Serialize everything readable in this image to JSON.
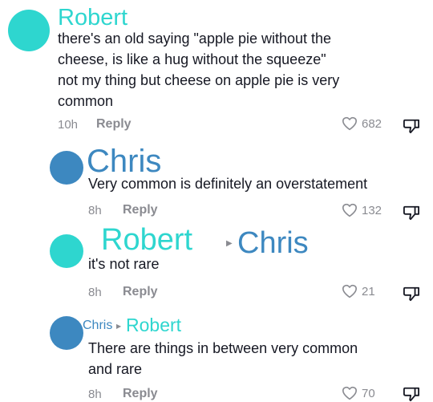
{
  "colors": {
    "teal": "#2ed6cf",
    "blue": "#3d88c0",
    "gray": "#8a8b91"
  },
  "comments": [
    {
      "author": "Robert",
      "text_lines": [
        "there's an old saying \"apple pie without the",
        "cheese, is like a hug without the squeeze\"",
        "not my thing but cheese on apple pie is very",
        "common"
      ],
      "time": "10h",
      "reply_label": "Reply",
      "likes": "682"
    },
    {
      "author": "Chris",
      "text_lines": [
        "Very common is definitely an overstatement"
      ],
      "time": "8h",
      "reply_label": "Reply",
      "likes": "132"
    },
    {
      "author": "Robert",
      "reply_to": "Chris",
      "text_lines": [
        "it's not rare"
      ],
      "time": "8h",
      "reply_label": "Reply",
      "likes": "21"
    },
    {
      "author": "Robert",
      "reply_to_prefix": "Chris",
      "text_lines": [
        "There are things in between very common",
        "and rare"
      ],
      "time": "8h",
      "reply_label": "Reply",
      "likes": "70"
    }
  ],
  "icons": {
    "like": "heart-outline-icon",
    "dislike": "thumbs-down-icon",
    "reply_arrow": "caret-right-icon"
  }
}
